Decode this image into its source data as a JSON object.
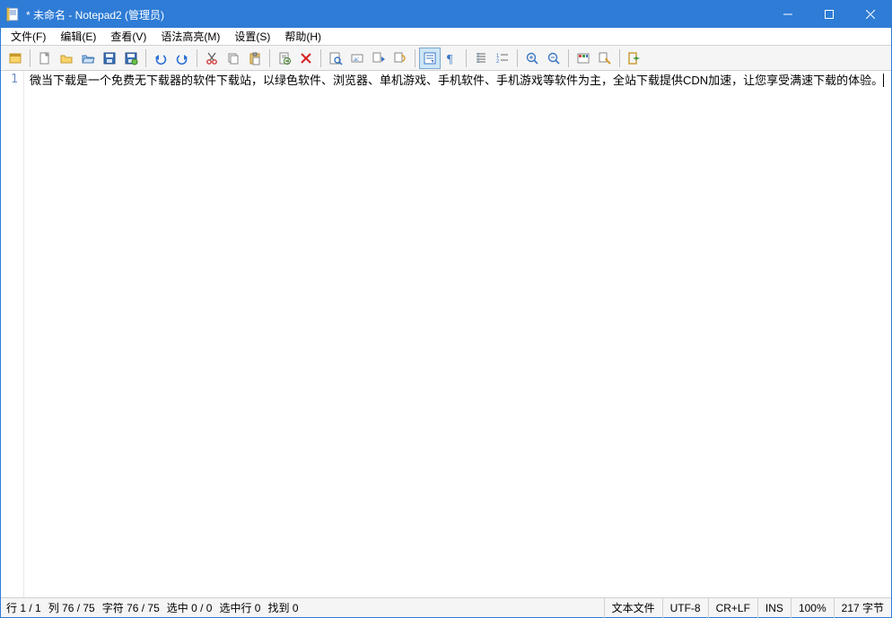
{
  "titlebar": {
    "title": "* 未命名 - Notepad2 (管理员)"
  },
  "menubar": {
    "file": "文件(F)",
    "edit": "编辑(E)",
    "view": "查看(V)",
    "syntax": "语法高亮(M)",
    "settings": "设置(S)",
    "help": "帮助(H)"
  },
  "toolbar": {
    "icons": [
      "new-window",
      "|",
      "new-file",
      "open-file",
      "favorites",
      "save",
      "|",
      "undo",
      "redo",
      "|",
      "cut",
      "copy",
      "paste",
      "|",
      "find-replace",
      "delete",
      "|",
      "find",
      "find-word",
      "find-next",
      "find-prev",
      "|",
      "toggle-ws",
      "select-mode",
      "|",
      "zoom-in",
      "zoom-out",
      "|",
      "syntax-color",
      "settings-highlight",
      "|",
      "exit"
    ]
  },
  "editor": {
    "line_number": "1",
    "text": "微当下载是一个免费无下载器的软件下载站，以绿色软件、浏览器、单机游戏、手机软件、手机游戏等软件为主，全站下载提供CDN加速，让您享受满速下载的体验。"
  },
  "statusbar": {
    "left": {
      "line": "行 1 / 1",
      "col": "列 76 / 75",
      "char": "字符 76 / 75",
      "sel": "选中 0 / 0",
      "sel_line": "选中行 0",
      "matches": "找到 0"
    },
    "right": {
      "filetype": "文本文件",
      "encoding": "UTF-8",
      "eol": "CR+LF",
      "ovr": "INS",
      "zoom": "100%",
      "size": "217 字节"
    }
  }
}
